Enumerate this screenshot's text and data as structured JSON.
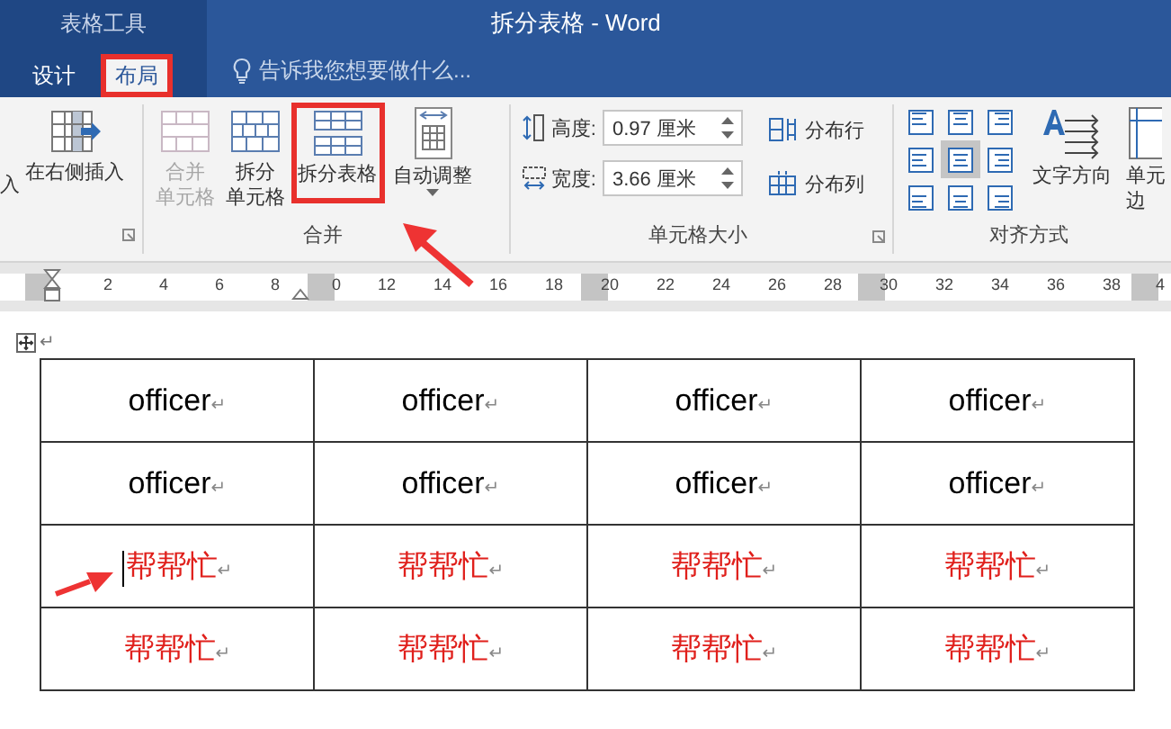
{
  "context_tab_group": "表格工具",
  "window": {
    "title": "拆分表格 - Word"
  },
  "tabs": [
    {
      "label": "设计",
      "selected": false,
      "highlighted": false
    },
    {
      "label": "布局",
      "selected": true,
      "highlighted": true
    }
  ],
  "tell_me": {
    "placeholder": "告诉我您想要做什么..."
  },
  "insert_group": {
    "cut_label": "入",
    "button": "在右侧插入"
  },
  "merge_group": {
    "label": "合并",
    "buttons": [
      {
        "lines": [
          "合并",
          "单元格"
        ],
        "disabled": true,
        "highlighted": false
      },
      {
        "lines": [
          "拆分",
          "单元格"
        ],
        "disabled": false,
        "highlighted": false
      },
      {
        "lines": [
          "拆分表格"
        ],
        "disabled": false,
        "highlighted": true
      }
    ]
  },
  "autofit": {
    "label": "自动调整"
  },
  "cell_size_group": {
    "label": "单元格大小",
    "height": {
      "label": "高度:",
      "value": "0.97 厘米"
    },
    "width": {
      "label": "宽度:",
      "value": "3.66 厘米"
    },
    "distribute": [
      "分布行",
      "分布列"
    ]
  },
  "alignment_group": {
    "label": "对齐方式",
    "alignments": [
      {
        "selected": false
      },
      {
        "selected": false
      },
      {
        "selected": false
      },
      {
        "selected": false
      },
      {
        "selected": true
      },
      {
        "selected": false
      },
      {
        "selected": false
      },
      {
        "selected": false
      },
      {
        "selected": false
      }
    ],
    "text_direction": "文字方向",
    "cell_margins": [
      "单元",
      "边"
    ]
  },
  "ruler": {
    "ticks": [
      "2",
      "4",
      "6",
      "8",
      "0",
      "12",
      "14",
      "16",
      "18",
      "20",
      "22",
      "24",
      "26",
      "28",
      "30",
      "32",
      "34",
      "36",
      "38",
      "4"
    ]
  },
  "document": {
    "paragraph_mark": "↵",
    "table": {
      "rows": [
        {
          "color": "#000000",
          "cells": [
            {
              "text": "officer",
              "mark": "↵",
              "cursor": false
            },
            {
              "text": "officer",
              "mark": "↵",
              "cursor": false
            },
            {
              "text": "officer",
              "mark": "↵",
              "cursor": false
            },
            {
              "text": "officer",
              "mark": "↵",
              "cursor": false
            }
          ]
        },
        {
          "color": "#000000",
          "cells": [
            {
              "text": "officer",
              "mark": "↵",
              "cursor": false
            },
            {
              "text": "officer",
              "mark": "↵",
              "cursor": false
            },
            {
              "text": "officer",
              "mark": "↵",
              "cursor": false
            },
            {
              "text": "officer",
              "mark": "↵",
              "cursor": false
            }
          ]
        },
        {
          "color": "#e0201c",
          "cells": [
            {
              "text": "帮帮忙",
              "mark": "↵",
              "cursor": true
            },
            {
              "text": "帮帮忙",
              "mark": "↵",
              "cursor": false
            },
            {
              "text": "帮帮忙",
              "mark": "↵",
              "cursor": false
            },
            {
              "text": "帮帮忙",
              "mark": "↵",
              "cursor": false
            }
          ]
        },
        {
          "color": "#e0201c",
          "cells": [
            {
              "text": "帮帮忙",
              "mark": "↵",
              "cursor": false
            },
            {
              "text": "帮帮忙",
              "mark": "↵",
              "cursor": false
            },
            {
              "text": "帮帮忙",
              "mark": "↵",
              "cursor": false
            },
            {
              "text": "帮帮忙",
              "mark": "↵",
              "cursor": false
            }
          ]
        }
      ]
    }
  }
}
